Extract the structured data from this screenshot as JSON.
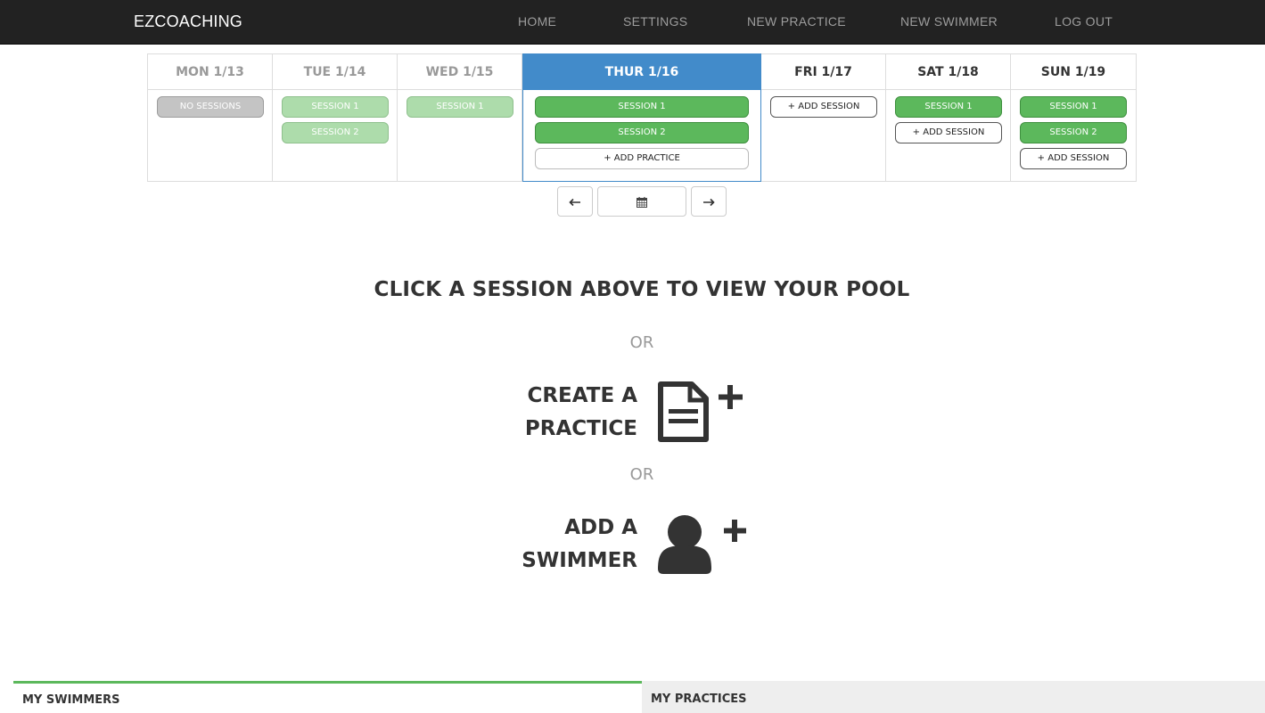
{
  "navbar": {
    "brand": "EZCOACHING",
    "links": [
      "HOME",
      "SETTINGS",
      "NEW PRACTICE",
      "NEW SWIMMER",
      "LOG OUT"
    ]
  },
  "week": {
    "days": [
      {
        "label": "MON 1/13",
        "state": "past",
        "items": [
          "NO SESSIONS"
        ]
      },
      {
        "label": "TUE 1/14",
        "state": "past",
        "items": [
          "SESSION 1",
          "SESSION 2"
        ]
      },
      {
        "label": "WED 1/15",
        "state": "past",
        "items": [
          "SESSION 1"
        ]
      },
      {
        "label": "THUR 1/16",
        "state": "today",
        "items": [
          "SESSION 1",
          "SESSION 2",
          "+ ADD PRACTICE"
        ]
      },
      {
        "label": "FRI 1/17",
        "state": "future",
        "items": [
          "+ ADD SESSION"
        ]
      },
      {
        "label": "SAT 1/18",
        "state": "future",
        "items": [
          "SESSION 1",
          "+ ADD SESSION"
        ]
      },
      {
        "label": "SUN 1/19",
        "state": "future",
        "items": [
          "SESSION 1",
          "SESSION 2",
          "+ ADD SESSION"
        ]
      }
    ],
    "prev_icon": "arrow-left-icon",
    "calendar_icon": "calendar-icon",
    "next_icon": "arrow-right-icon"
  },
  "main": {
    "headline": "CLICK A SESSION ABOVE TO VIEW YOUR POOL",
    "or": "OR",
    "create_practice": {
      "line1": "CREATE A",
      "line2": "PRACTICE",
      "icon": "document-plus-icon"
    },
    "add_swimmer": {
      "line1": "ADD A",
      "line2": "SWIMMER",
      "icon": "user-plus-icon"
    }
  },
  "tabs": {
    "swimmers": "MY SWIMMERS",
    "practices": "MY PRACTICES"
  },
  "colors": {
    "navbar_bg": "#222222",
    "active_day": "#428bca",
    "session_green": "#5cb85c",
    "session_past": "#addcab",
    "no_session": "#c4c4c4"
  }
}
